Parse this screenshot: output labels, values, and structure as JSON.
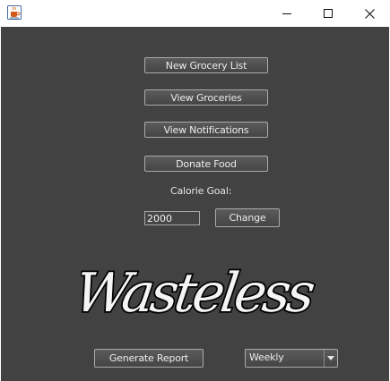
{
  "window": {
    "icons": {
      "app": "java-coffee-cup-icon",
      "minimize": "minimize-icon",
      "maximize": "maximize-icon",
      "close": "close-icon"
    }
  },
  "menu": {
    "new_grocery_list": "New Grocery List",
    "view_groceries": "View Groceries",
    "view_notifications": "View Notifications",
    "donate_food": "Donate Food"
  },
  "calorie": {
    "label": "Calorie Goal:",
    "value": "2000",
    "change_label": "Change"
  },
  "logo": {
    "text": "Wasteless"
  },
  "report": {
    "generate_label": "Generate Report",
    "period_selected": "Weekly"
  },
  "colors": {
    "background": "#424242",
    "button": "#4f4f4f",
    "button_border": "#ababab",
    "text": "#ececec",
    "logo_fill": "#f4f4f4",
    "logo_outline": "#000000"
  }
}
